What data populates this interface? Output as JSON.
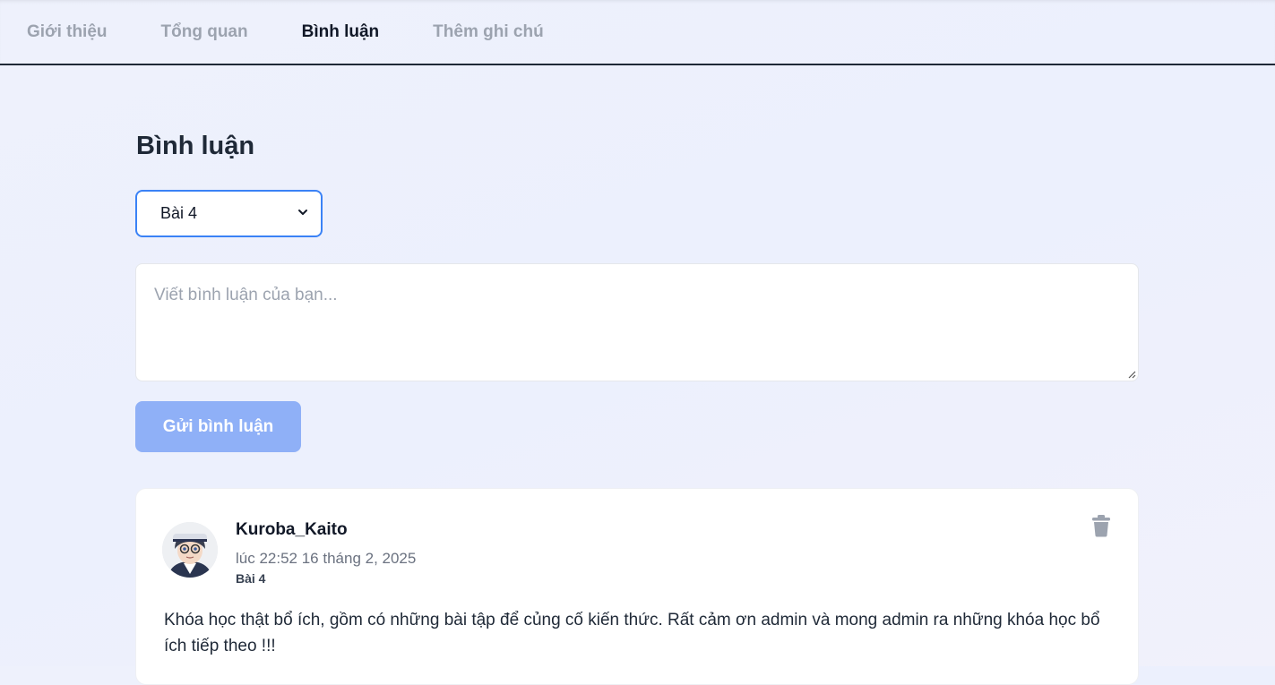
{
  "tabs": [
    {
      "label": "Giới thiệu"
    },
    {
      "label": "Tổng quan"
    },
    {
      "label": "Bình luận"
    },
    {
      "label": "Thêm ghi chú"
    }
  ],
  "comments_section": {
    "title": "Bình luận",
    "lesson_select": {
      "selected": "Bài 4"
    },
    "comment_input": {
      "placeholder": "Viết bình luận của bạn..."
    },
    "submit_label": "Gửi bình luận"
  },
  "comments": [
    {
      "username": "Kuroba_Kaito",
      "time": "lúc 22:52 16 tháng 2, 2025",
      "lesson": "Bài 4",
      "content": "Khóa học thật bổ ích, gồm có những bài tập để củng cố kiến thức. Rất cảm ơn admin và mong admin ra những khóa học bổ ích tiếp theo !!!"
    }
  ],
  "icons": {
    "select_chevron": "chevron-down-icon",
    "delete": "trash-icon",
    "resize": "resize-handle-icon"
  },
  "colors": {
    "accent": "#3b82f6",
    "submit_disabled": "#8fb0f7",
    "active_tab": "#111827",
    "inactive_tab": "#9ca3af"
  }
}
